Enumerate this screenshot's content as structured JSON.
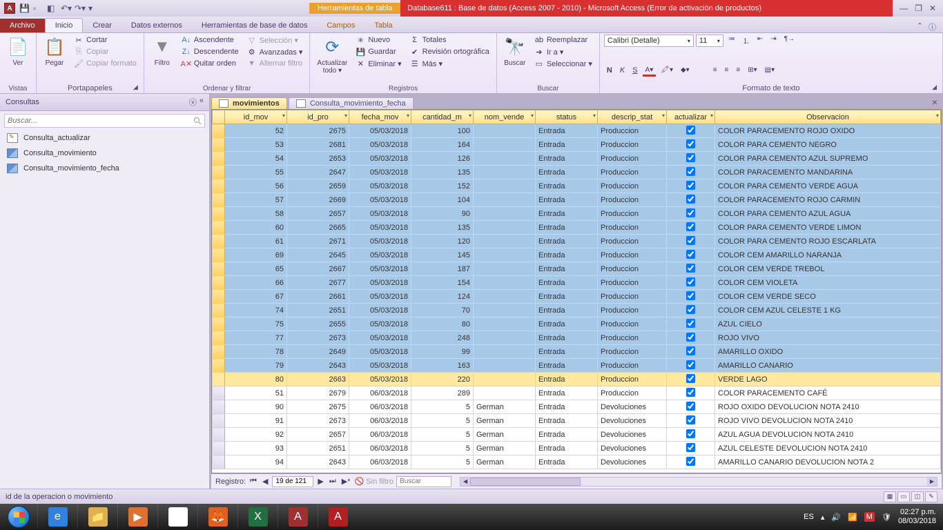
{
  "title_context": "Herramientas de tabla",
  "window_title": "Database611 : Base de datos (Access 2007 - 2010)  -  Microsoft Access (Error de activación de productos)",
  "ribbon": {
    "file": "Archivo",
    "tabs": [
      "Inicio",
      "Crear",
      "Datos externos",
      "Herramientas de base de datos",
      "Campos",
      "Tabla"
    ],
    "active": "Inicio",
    "groups": {
      "vistas": {
        "label": "Vistas",
        "ver": "Ver"
      },
      "portapapeles": {
        "label": "Portapapeles",
        "pegar": "Pegar",
        "cortar": "Cortar",
        "copiar": "Copiar",
        "copiar_formato": "Copiar formato"
      },
      "ordenar": {
        "label": "Ordenar y filtrar",
        "filtro": "Filtro",
        "asc": "Ascendente",
        "desc": "Descendente",
        "quitar": "Quitar orden",
        "sel": "Selección ▾",
        "avz": "Avanzadas ▾",
        "alt": "Alternar filtro"
      },
      "registros": {
        "label": "Registros",
        "actualizar": "Actualizar\ntodo ▾",
        "nuevo": "Nuevo",
        "guardar": "Guardar",
        "eliminar": "Eliminar ▾",
        "totales": "Totales",
        "rev": "Revisión ortográfica",
        "mas": "Más ▾"
      },
      "buscar": {
        "label": "Buscar",
        "buscar": "Buscar",
        "reemplazar": "Reemplazar",
        "ir": "Ir a ▾",
        "selec": "Seleccionar ▾"
      },
      "formato": {
        "label": "Formato de texto",
        "font": "Calibri (Detalle)",
        "size": "11"
      }
    }
  },
  "nav": {
    "header": "Consultas",
    "search_placeholder": "Buscar...",
    "items": [
      {
        "label": "Consulta_actualizar",
        "type": "upd"
      },
      {
        "label": "Consulta_movimiento",
        "type": "sel"
      },
      {
        "label": "Consulta_movimiento_fecha",
        "type": "sel"
      }
    ]
  },
  "tabs": {
    "active": "movimientos",
    "inactive": "Consulta_movimiento_fecha"
  },
  "columns": [
    "id_mov",
    "id_pro",
    "fecha_mov",
    "cantidad_m",
    "nom_vende",
    "status",
    "descrip_stat",
    "actualizar",
    "Observacion"
  ],
  "rows": [
    {
      "sel": true,
      "id_mov": 52,
      "id_pro": 2675,
      "fecha": "05/03/2018",
      "cant": 100,
      "vend": "",
      "status": "Entrada",
      "desc": "Produccion",
      "act": true,
      "obs": "COLOR PARACEMENTO ROJO OXIDO"
    },
    {
      "sel": true,
      "id_mov": 53,
      "id_pro": 2681,
      "fecha": "05/03/2018",
      "cant": 164,
      "vend": "",
      "status": "Entrada",
      "desc": "Produccion",
      "act": true,
      "obs": "COLOR PARA CEMENTO NEGRO"
    },
    {
      "sel": true,
      "id_mov": 54,
      "id_pro": 2653,
      "fecha": "05/03/2018",
      "cant": 126,
      "vend": "",
      "status": "Entrada",
      "desc": "Produccion",
      "act": true,
      "obs": "COLOR PARA CEMENTO AZUL SUPREMO"
    },
    {
      "sel": true,
      "id_mov": 55,
      "id_pro": 2647,
      "fecha": "05/03/2018",
      "cant": 135,
      "vend": "",
      "status": "Entrada",
      "desc": "Produccion",
      "act": true,
      "obs": "COLOR PARACEMENTO MANDARINA"
    },
    {
      "sel": true,
      "id_mov": 56,
      "id_pro": 2659,
      "fecha": "05/03/2018",
      "cant": 152,
      "vend": "",
      "status": "Entrada",
      "desc": "Produccion",
      "act": true,
      "obs": "COLOR PARA CEMENTO VERDE AGUA"
    },
    {
      "sel": true,
      "id_mov": 57,
      "id_pro": 2669,
      "fecha": "05/03/2018",
      "cant": 104,
      "vend": "",
      "status": "Entrada",
      "desc": "Produccion",
      "act": true,
      "obs": "COLOR PARACEMENTO ROJO CARMIN"
    },
    {
      "sel": true,
      "id_mov": 58,
      "id_pro": 2657,
      "fecha": "05/03/2018",
      "cant": 90,
      "vend": "",
      "status": "Entrada",
      "desc": "Produccion",
      "act": true,
      "obs": "COLOR PARA CEMENTO AZUL AGUA"
    },
    {
      "sel": true,
      "id_mov": 60,
      "id_pro": 2665,
      "fecha": "05/03/2018",
      "cant": 135,
      "vend": "",
      "status": "Entrada",
      "desc": "Produccion",
      "act": true,
      "obs": "COLOR PARA CEMENTO VERDE LIMON"
    },
    {
      "sel": true,
      "id_mov": 61,
      "id_pro": 2671,
      "fecha": "05/03/2018",
      "cant": 120,
      "vend": "",
      "status": "Entrada",
      "desc": "Produccion",
      "act": true,
      "obs": "COLOR PARA CEMENTO ROJO ESCARLATA"
    },
    {
      "sel": true,
      "id_mov": 69,
      "id_pro": 2645,
      "fecha": "05/03/2018",
      "cant": 145,
      "vend": "",
      "status": "Entrada",
      "desc": "Produccion",
      "act": true,
      "obs": "COLOR CEM AMARILLO NARANJA"
    },
    {
      "sel": true,
      "id_mov": 65,
      "id_pro": 2667,
      "fecha": "05/03/2018",
      "cant": 187,
      "vend": "",
      "status": "Entrada",
      "desc": "Produccion",
      "act": true,
      "obs": "COLOR CEM VERDE TREBOL"
    },
    {
      "sel": true,
      "id_mov": 66,
      "id_pro": 2677,
      "fecha": "05/03/2018",
      "cant": 154,
      "vend": "",
      "status": "Entrada",
      "desc": "Produccion",
      "act": true,
      "obs": "COLOR CEM VIOLETA"
    },
    {
      "sel": true,
      "id_mov": 67,
      "id_pro": 2661,
      "fecha": "05/03/2018",
      "cant": 124,
      "vend": "",
      "status": "Entrada",
      "desc": "Produccion",
      "act": true,
      "obs": "COLOR CEM VERDE SECO"
    },
    {
      "sel": true,
      "id_mov": 74,
      "id_pro": 2651,
      "fecha": "05/03/2018",
      "cant": 70,
      "vend": "",
      "status": "Entrada",
      "desc": "Produccion",
      "act": true,
      "obs": "COLOR CEM AZUL CELESTE 1 KG"
    },
    {
      "sel": true,
      "id_mov": 75,
      "id_pro": 2655,
      "fecha": "05/03/2018",
      "cant": 80,
      "vend": "",
      "status": "Entrada",
      "desc": "Produccion",
      "act": true,
      "obs": "AZUL CIELO"
    },
    {
      "sel": true,
      "id_mov": 77,
      "id_pro": 2673,
      "fecha": "05/03/2018",
      "cant": 248,
      "vend": "",
      "status": "Entrada",
      "desc": "Produccion",
      "act": true,
      "obs": "ROJO VIVO"
    },
    {
      "sel": true,
      "id_mov": 78,
      "id_pro": 2649,
      "fecha": "05/03/2018",
      "cant": 99,
      "vend": "",
      "status": "Entrada",
      "desc": "Produccion",
      "act": true,
      "obs": "AMARILLO OXIDO"
    },
    {
      "sel": true,
      "id_mov": 79,
      "id_pro": 2643,
      "fecha": "05/03/2018",
      "cant": 163,
      "vend": "",
      "status": "Entrada",
      "desc": "Produccion",
      "act": true,
      "obs": "AMARILLO CANARIO"
    },
    {
      "sel": true,
      "cursor": true,
      "id_mov": 80,
      "id_pro": 2663,
      "fecha": "05/03/2018",
      "cant": 220,
      "vend": "",
      "status": "Entrada",
      "desc": "Produccion",
      "act": true,
      "obs": "VERDE LAGO"
    },
    {
      "sel": false,
      "id_mov": 51,
      "id_pro": 2679,
      "fecha": "06/03/2018",
      "cant": 289,
      "vend": "",
      "status": "Entrada",
      "desc": "Produccion",
      "act": true,
      "obs": "COLOR PARACEMENTO CAFÉ"
    },
    {
      "sel": false,
      "id_mov": 90,
      "id_pro": 2675,
      "fecha": "06/03/2018",
      "cant": 5,
      "vend": "German",
      "status": "Entrada",
      "desc": "Devoluciones",
      "act": true,
      "obs": "ROJO OXIDO  DEVOLUCION NOTA 2410"
    },
    {
      "sel": false,
      "id_mov": 91,
      "id_pro": 2673,
      "fecha": "06/03/2018",
      "cant": 5,
      "vend": "German",
      "status": "Entrada",
      "desc": "Devoluciones",
      "act": true,
      "obs": "ROJO VIVO DEVOLUCION NOTA 2410"
    },
    {
      "sel": false,
      "id_mov": 92,
      "id_pro": 2657,
      "fecha": "06/03/2018",
      "cant": 5,
      "vend": "German",
      "status": "Entrada",
      "desc": "Devoluciones",
      "act": true,
      "obs": "AZUL AGUA DEVOLUCION NOTA 2410"
    },
    {
      "sel": false,
      "id_mov": 93,
      "id_pro": 2651,
      "fecha": "06/03/2018",
      "cant": 5,
      "vend": "German",
      "status": "Entrada",
      "desc": "Devoluciones",
      "act": true,
      "obs": "AZUL CELESTE DEVOLUCION NOTA 2410"
    },
    {
      "sel": false,
      "id_mov": 94,
      "id_pro": 2643,
      "fecha": "06/03/2018",
      "cant": 5,
      "vend": "German",
      "status": "Entrada",
      "desc": "Devoluciones",
      "act": true,
      "obs": "AMARILLO CANARIO DEVOLUCION NOTA 2"
    }
  ],
  "recnav": {
    "label": "Registro:",
    "pos": "19 de 121",
    "filter": "Sin filtro",
    "search": "Buscar"
  },
  "status": "id de la operacion o movimiento",
  "systray": {
    "lang": "ES",
    "time": "02:27 p.m.",
    "date": "08/03/2018"
  }
}
